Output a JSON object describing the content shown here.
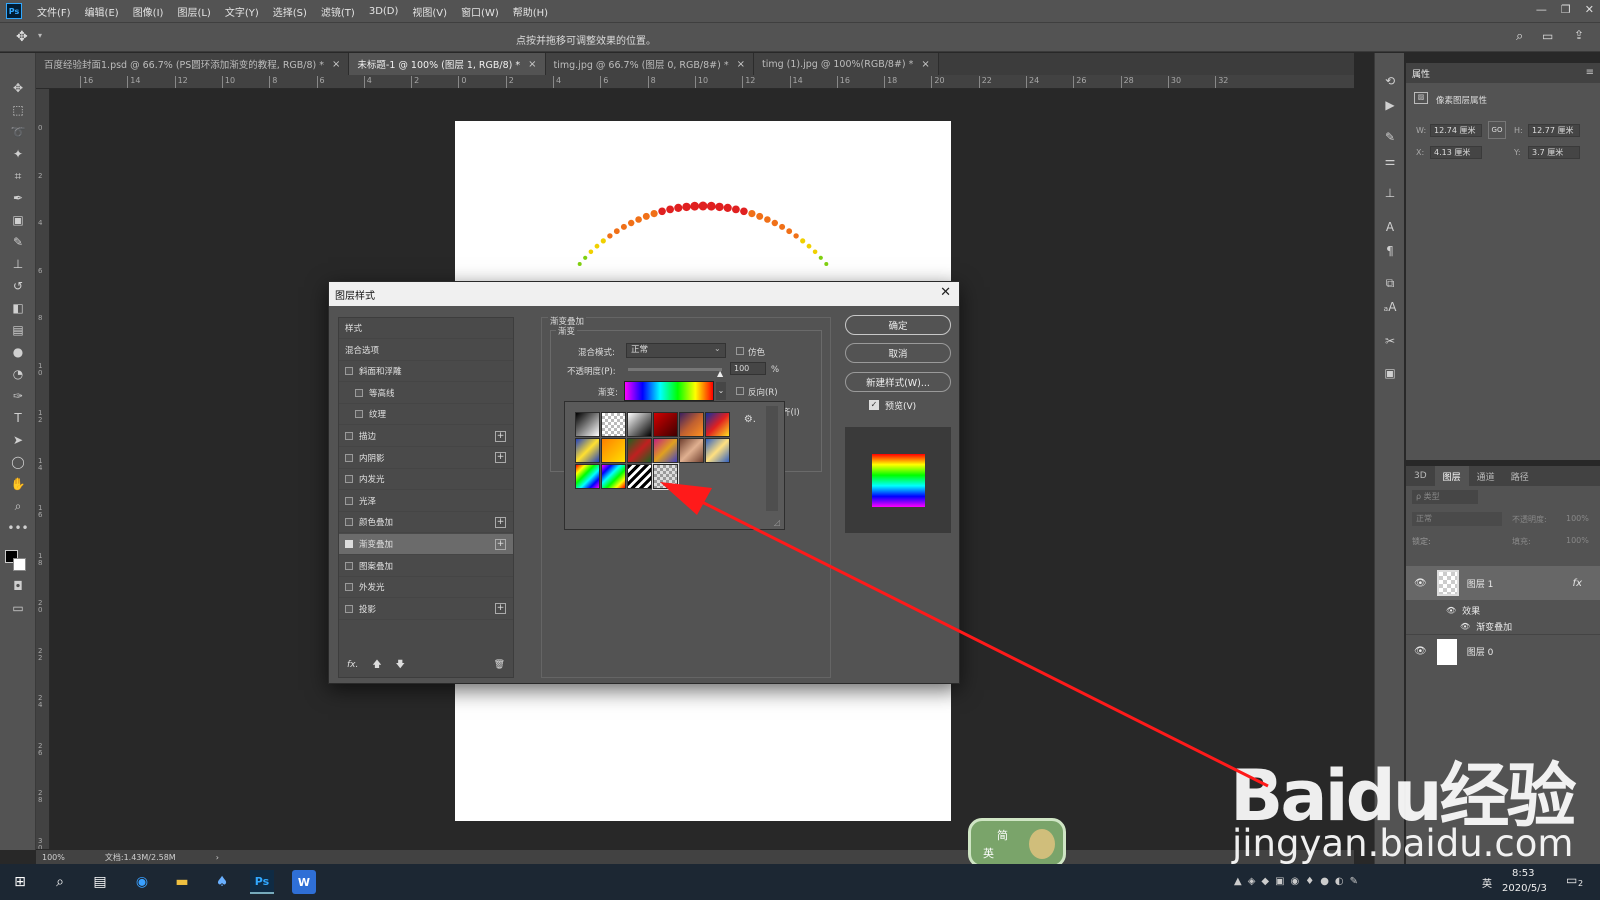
{
  "menubar": {
    "logo": "Ps",
    "items": [
      "文件(F)",
      "编辑(E)",
      "图像(I)",
      "图层(L)",
      "文字(Y)",
      "选择(S)",
      "滤镜(T)",
      "3D(D)",
      "视图(V)",
      "窗口(W)",
      "帮助(H)"
    ]
  },
  "options": {
    "hint": "点按并拖移可调整效果的位置。"
  },
  "tabs": [
    {
      "label": "百度经验封面1.psd @ 66.7% (PS圆环添加渐变的教程, RGB/8) *"
    },
    {
      "label": "未标题-1 @ 100% (图层 1, RGB/8) *"
    },
    {
      "label": "timg.jpg @ 66.7% (图层 0, RGB/8#) *"
    },
    {
      "label": "timg (1).jpg @ 100%(RGB/8#) *"
    }
  ],
  "ruler": {
    "h_ticks": [
      "16",
      "14",
      "12",
      "10",
      "8",
      "6",
      "4",
      "2",
      "0",
      "2",
      "4",
      "6",
      "8",
      "10",
      "12",
      "14",
      "16",
      "18",
      "20",
      "22",
      "24",
      "26",
      "28",
      "30",
      "32"
    ],
    "v_ticks": [
      "0",
      "2",
      "4",
      "6",
      "8",
      "1 0",
      "1 2",
      "1 4",
      "1 6",
      "1 8",
      "2 0",
      "2 2",
      "2 4",
      "2 6",
      "2 8",
      "3 0"
    ]
  },
  "status": {
    "zoom": "100%",
    "doc_size": "文档:1.43M/2.58M"
  },
  "properties": {
    "title": "属性",
    "subtitle": "像素图层属性",
    "w_label": "W:",
    "w": "12.74 厘米",
    "h_label": "H:",
    "h": "12.77 厘米",
    "x_label": "X:",
    "x": "4.13 厘米",
    "y_label": "Y:",
    "y": "3.7 厘米",
    "link_label": "GO"
  },
  "layers": {
    "tabs": [
      "3D",
      "图层",
      "通道",
      "路径"
    ],
    "filter_placeholder": "ρ 类型",
    "blend": "正常",
    "opacity_label": "不透明度:",
    "opacity": "100%",
    "lock_label": "锁定:",
    "fill_label": "填充:",
    "fill": "100%",
    "items": [
      {
        "name": "图层 1",
        "fx": "fx"
      },
      {
        "name": "效果"
      },
      {
        "name": "渐变叠加"
      },
      {
        "name": "图层 0"
      }
    ]
  },
  "dialog": {
    "title": "图层样式",
    "styles": [
      {
        "label": "样式",
        "type": "header"
      },
      {
        "label": "混合选项",
        "type": "header"
      },
      {
        "label": "斜面和浮雕",
        "checked": false
      },
      {
        "label": "等高线",
        "checked": false,
        "indent": true
      },
      {
        "label": "纹理",
        "checked": false,
        "indent": true
      },
      {
        "label": "描边",
        "checked": false,
        "plus": true
      },
      {
        "label": "内阴影",
        "checked": false,
        "plus": true
      },
      {
        "label": "内发光",
        "checked": false
      },
      {
        "label": "光泽",
        "checked": false
      },
      {
        "label": "颜色叠加",
        "checked": false,
        "plus": true
      },
      {
        "label": "渐变叠加",
        "checked": true,
        "plus": true,
        "selected": true
      },
      {
        "label": "图案叠加",
        "checked": false
      },
      {
        "label": "外发光",
        "checked": false
      },
      {
        "label": "投影",
        "checked": false,
        "plus": true
      }
    ],
    "footer_fx": "fx.",
    "section_title": "渐变叠加",
    "group_title": "渐变",
    "blend_label": "混合模式:",
    "blend_value": "正常",
    "dither_label": "仿色",
    "opacity_label": "不透明度(P):",
    "opacity_value": "100",
    "opacity_unit": "%",
    "opacity_level": 1.0,
    "gradient_label": "渐变:",
    "reverse_label": "反向(R)",
    "align_partial": "齐(I)",
    "ok": "确定",
    "cancel": "取消",
    "new_style": "新建样式(W)...",
    "preview_label": "预览(V)"
  },
  "picker": {
    "gear": "⚙."
  },
  "taskbar": {
    "time": "8:53",
    "date": "2020/5/3",
    "ime": "英",
    "notif_count": "2"
  },
  "watermark": {
    "brand": "Baidu经验",
    "url": "jingyan.baidu.com"
  },
  "badge": {
    "top": "简",
    "left": "英"
  },
  "colors": {
    "ui_dark": "#535353",
    "arrow": "#ff1a1a",
    "dot_red": "#e02020",
    "dot_yellow": "#f0d000",
    "dot_green": "#80d010"
  }
}
